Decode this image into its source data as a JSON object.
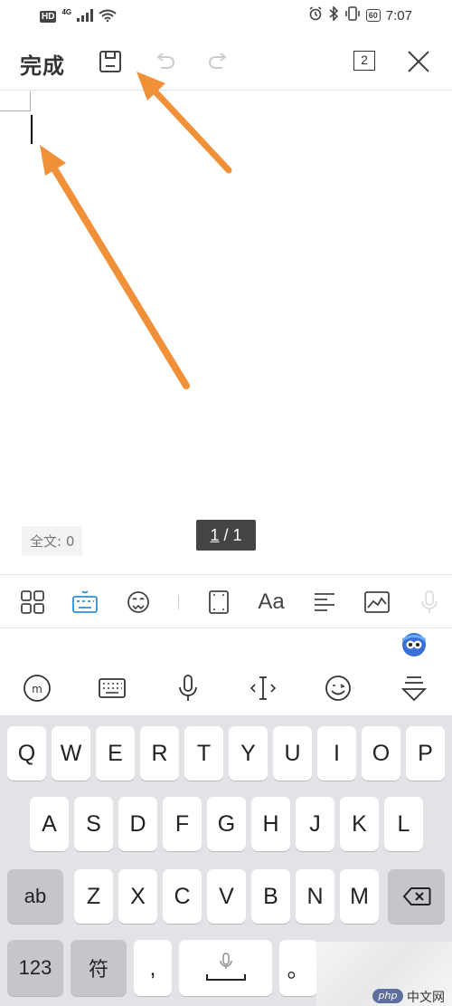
{
  "status_bar": {
    "hd_label": "HD",
    "network_label": "4G",
    "battery_level": "60",
    "time": "7:07"
  },
  "toolbar": {
    "done_label": "完成",
    "page_count": "2",
    "icons": [
      "save-icon",
      "undo-icon",
      "redo-icon",
      "page-count-icon",
      "close-icon"
    ]
  },
  "document": {
    "word_count_label": "全文: 0",
    "page_current": "1",
    "page_separator": " / ",
    "page_total": "1"
  },
  "format_bar": {
    "aa_label": "Aa",
    "icons": [
      "grid-apps-icon",
      "keyboard-icon",
      "sticker-icon",
      "page-frame-icon",
      "font-icon",
      "align-left-icon",
      "image-icon",
      "mic-icon"
    ]
  },
  "ime_toolbar": {
    "icons": [
      "ime-logo-icon",
      "keyboard-layout-icon",
      "microphone-icon",
      "cursor-move-icon",
      "emoji-icon",
      "collapse-keyboard-icon"
    ]
  },
  "keyboard": {
    "row1": [
      "Q",
      "W",
      "E",
      "R",
      "T",
      "Y",
      "U",
      "I",
      "O",
      "P"
    ],
    "row2": [
      "A",
      "S",
      "D",
      "F",
      "G",
      "H",
      "J",
      "K",
      "L"
    ],
    "row3": [
      "Z",
      "X",
      "C",
      "V",
      "B",
      "N",
      "M"
    ],
    "ab_label": "ab",
    "numbers_label": "123",
    "symbols_label": "符",
    "comma_label": ",",
    "period_label": "。"
  },
  "watermark": {
    "badge": "php",
    "text": "中文网"
  },
  "colors": {
    "arrow": "#f0913a",
    "keyboard_bg": "#e2e3e7",
    "accent_blue": "#2f8fd6"
  }
}
